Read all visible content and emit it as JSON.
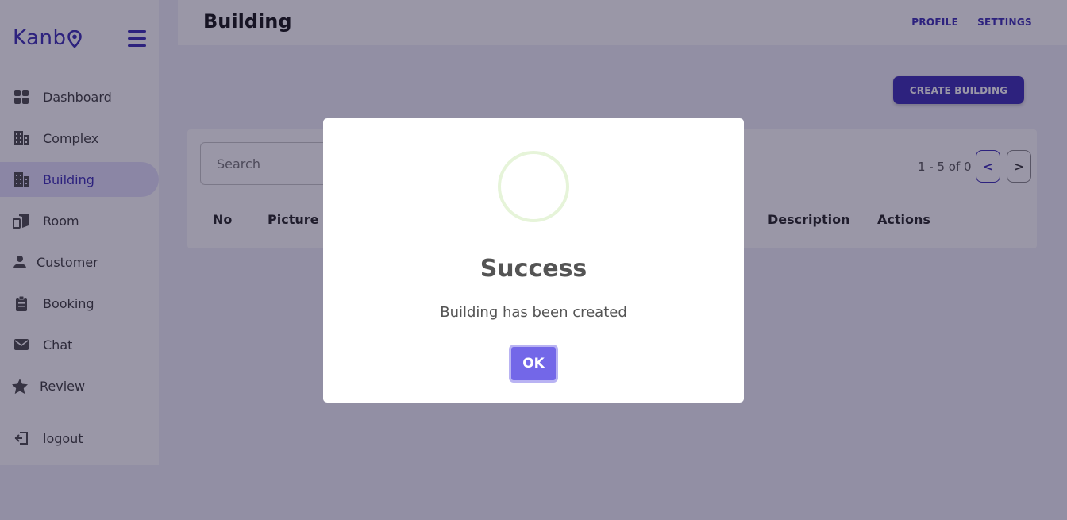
{
  "app": {
    "logo_text": "Kanb"
  },
  "sidebar": {
    "items": [
      {
        "label": "Dashboard",
        "icon": "dashboard-icon"
      },
      {
        "label": "Complex",
        "icon": "building-icon"
      },
      {
        "label": "Building",
        "icon": "building-icon",
        "active": true
      },
      {
        "label": "Room",
        "icon": "room-icon"
      },
      {
        "label": "Customer",
        "icon": "person-icon"
      },
      {
        "label": "Booking",
        "icon": "clipboard-icon"
      },
      {
        "label": "Chat",
        "icon": "envelope-icon"
      },
      {
        "label": "Review",
        "icon": "star-icon"
      }
    ],
    "logout_label": "logout"
  },
  "header": {
    "title": "Building",
    "links": {
      "profile": "PROFILE",
      "settings": "SETTINGS"
    }
  },
  "main": {
    "create_button": "CREATE BUILDING",
    "search_placeholder": "Search",
    "pager_text": "1 - 5 of 0",
    "pager_prev": "<",
    "pager_next": ">",
    "columns": {
      "no": "No",
      "picture": "Picture",
      "description": "Description",
      "actions": "Actions"
    }
  },
  "modal": {
    "title": "Success",
    "message": "Building has been created",
    "ok_label": "OK"
  },
  "colors": {
    "brand": "#3a2bb5",
    "ok_button": "#7367e8",
    "active_bg": "#e4e1fb"
  }
}
